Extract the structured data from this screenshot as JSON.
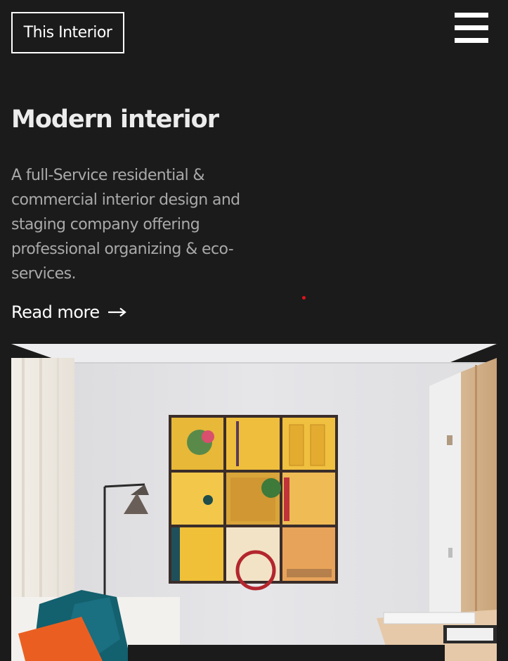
{
  "header": {
    "logo_text": "This Interior",
    "menu_icon": "hamburger-icon"
  },
  "hero": {
    "title": "Modern interior",
    "description": "A full-Service residential & commercial interior design and staging company offering professional organizing & eco-services.",
    "read_more_label": "Read more",
    "read_more_icon": "arrow-right-icon"
  },
  "colors": {
    "background": "#1b1b1b",
    "text_primary": "#ffffff",
    "text_muted": "#a9a9a9",
    "accent_dot": "#e0121b"
  }
}
